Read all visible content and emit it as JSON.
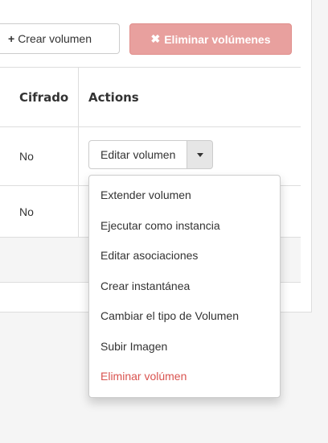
{
  "toolbar": {
    "create_label": "Crear volumen",
    "delete_label": "Eliminar volúmenes"
  },
  "table": {
    "headers": [
      "Cifrado",
      "Actions"
    ],
    "rows": [
      {
        "encrypted": "No"
      },
      {
        "encrypted": "No"
      }
    ]
  },
  "actions": {
    "primary_label": "Editar volumen",
    "menu_items": [
      "Extender volumen",
      "Ejecutar como instancia",
      "Editar asociaciones",
      "Crear instantánea",
      "Cambiar el tipo de Volumen",
      "Subir Imagen",
      "Eliminar volúmen"
    ]
  },
  "colors": {
    "danger_button_bg": "#e8a09e",
    "danger_text": "#d9534f",
    "border": "#dddddd"
  },
  "icons": {
    "create": "plus-icon",
    "delete": "x-icon",
    "dropdown": "caret-down-icon"
  }
}
